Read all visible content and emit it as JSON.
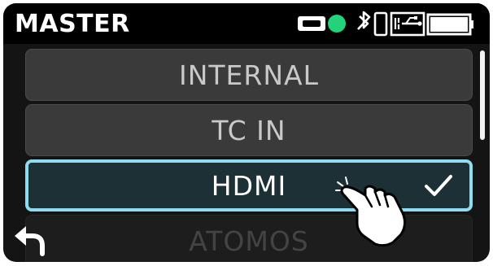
{
  "header": {
    "title": "MASTER"
  },
  "status_icons": [
    "hdmi-icon",
    "status-dot-icon",
    "bluetooth-icon",
    "device-icon",
    "usb-power-icon",
    "battery-icon"
  ],
  "accent_color": "#8fdcf0",
  "status_dot_color": "#22d37a",
  "menu": {
    "items": [
      {
        "label": "INTERNAL",
        "selected": false
      },
      {
        "label": "TC IN",
        "selected": false
      },
      {
        "label": "HDMI",
        "selected": true
      },
      {
        "label": "ATOMOS",
        "selected": false
      }
    ]
  }
}
